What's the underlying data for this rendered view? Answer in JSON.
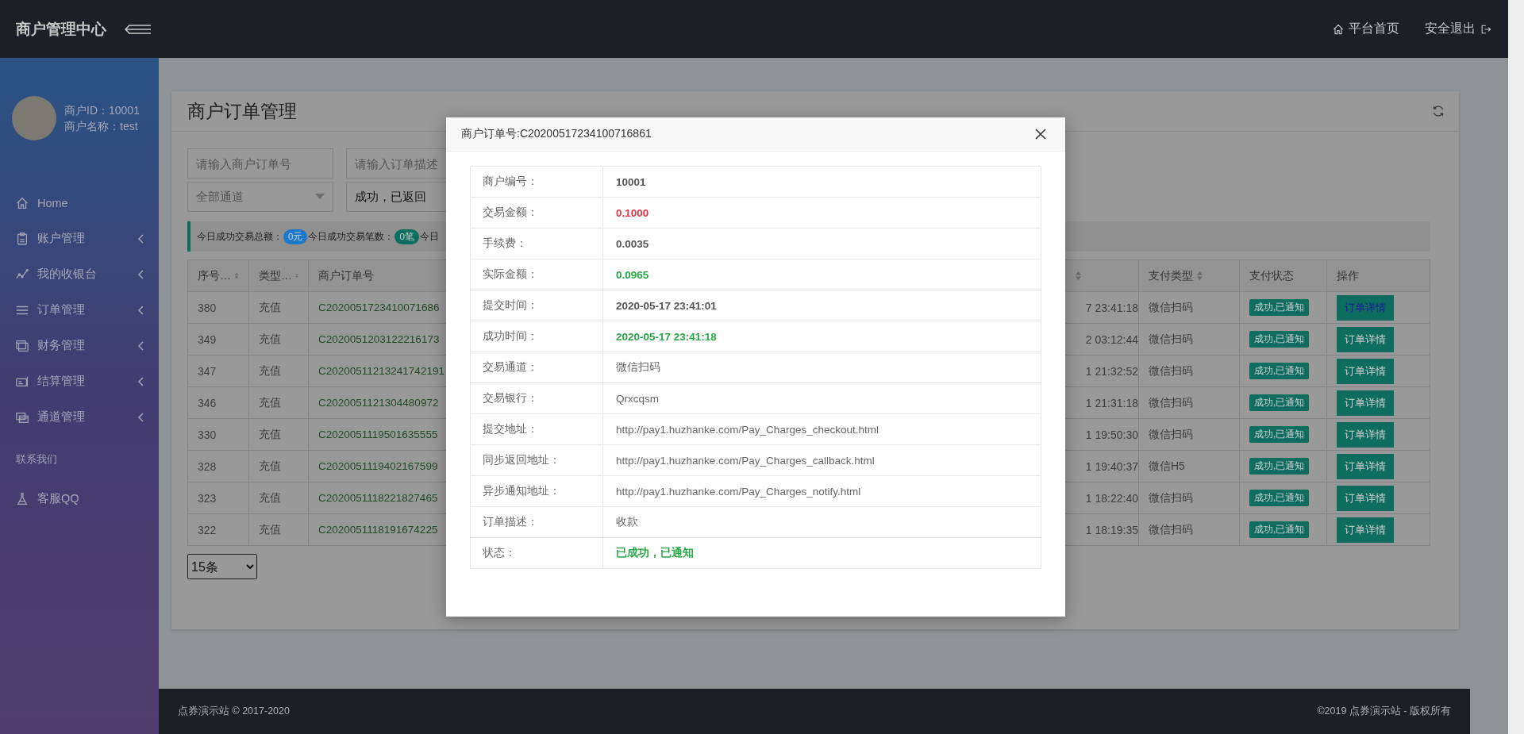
{
  "header": {
    "title": "商户管理中心",
    "links": [
      {
        "label": "平台首页"
      },
      {
        "label": "安全退出"
      }
    ]
  },
  "sidebar": {
    "user": {
      "id_line": "商户ID：10001",
      "name_line": "商户名称：test"
    },
    "menu": [
      {
        "label": "Home",
        "has_submenu": false
      },
      {
        "label": "账户管理",
        "has_submenu": true
      },
      {
        "label": "我的收银台",
        "has_submenu": true
      },
      {
        "label": "订单管理",
        "has_submenu": true
      },
      {
        "label": "财务管理",
        "has_submenu": true
      },
      {
        "label": "结算管理",
        "has_submenu": true
      },
      {
        "label": "通道管理",
        "has_submenu": true
      }
    ],
    "section_title": "联系我们",
    "contact": [
      {
        "label": "客服QQ",
        "has_submenu": false
      }
    ]
  },
  "page": {
    "title": "商户订单管理",
    "filters": [
      {
        "kind": "text",
        "placeholder": "请输入商户订单号"
      },
      {
        "kind": "text",
        "placeholder": "请输入订单描述"
      },
      {
        "kind": "dropdown",
        "value": "全部通道"
      },
      {
        "kind": "plain",
        "value": "成功，已返回"
      }
    ],
    "stats": [
      {
        "label": "今日成功交易总额：",
        "badge": "0元",
        "color": "#1d7acb"
      },
      {
        "label": "今日成功交易笔数：",
        "badge": "0笔",
        "color": "#0f6d5f"
      },
      {
        "label": "今日"
      }
    ],
    "table": {
      "columns": [
        {
          "label": "序号…",
          "sort": true
        },
        {
          "label": "类型…",
          "sort": true
        },
        {
          "label": "商户订单号",
          "sort": false
        },
        {
          "sort": true
        },
        {
          "label": "支付类型",
          "sort": true
        },
        {
          "label": "支付状态",
          "sort": false
        },
        {
          "label": "操作",
          "sort": false
        }
      ],
      "rows": [
        {
          "id": "380",
          "type": "充值",
          "order_no": "C2020051723410071686",
          "column_4": "7 23:41:18",
          "pay_type": "微信扫码",
          "status": "成功,已通知",
          "action": "订单详情",
          "selected": true
        },
        {
          "id": "349",
          "type": "充值",
          "order_no": "C2020051203122216173",
          "column_4": "2 03:12:44",
          "pay_type": "微信扫码",
          "status": "成功,已通知",
          "action": "订单详情",
          "selected": false
        },
        {
          "id": "347",
          "type": "充值",
          "order_no": "C20200511213241742191",
          "column_4": "1 21:32:52",
          "pay_type": "微信扫码",
          "status": "成功,已通知",
          "action": "订单详情",
          "selected": false
        },
        {
          "id": "346",
          "type": "充值",
          "order_no": "C2020051121304480972",
          "column_4": "1 21:31:18",
          "pay_type": "微信扫码",
          "status": "成功,已通知",
          "action": "订单详情",
          "selected": false
        },
        {
          "id": "330",
          "type": "充值",
          "order_no": "C2020051119501635555",
          "column_4": "1 19:50:30",
          "pay_type": "微信扫码",
          "status": "成功,已通知",
          "action": "订单详情",
          "selected": false
        },
        {
          "id": "328",
          "type": "充值",
          "order_no": "C2020051119402167599",
          "column_4": "1 19:40:37",
          "pay_type": "微信H5",
          "status": "成功,已通知",
          "action": "订单详情",
          "selected": false
        },
        {
          "id": "323",
          "type": "充值",
          "order_no": "C2020051118221827465",
          "column_4": "1 18:22:40",
          "pay_type": "微信扫码",
          "status": "成功,已通知",
          "action": "订单详情",
          "selected": false
        },
        {
          "id": "322",
          "type": "充值",
          "order_no": "C2020051118191674225",
          "column_4": "1 18:19:35",
          "pay_type": "微信扫码",
          "status": "成功,已通知",
          "action": "订单详情",
          "selected": false
        }
      ]
    },
    "page_size": "15条"
  },
  "footer": {
    "left": "点券演示站 © 2017-2020",
    "right": "©2019 点券演示站 - 版权所有"
  },
  "modal": {
    "title": "商户订单号:C20200517234100716861",
    "rows": [
      {
        "label": "商户编号：",
        "value": "10001",
        "kind": "bold"
      },
      {
        "label": "交易金额：",
        "value": "0.1000",
        "kind": "danger"
      },
      {
        "label": "手续费：",
        "value": "0.0035",
        "kind": "bold"
      },
      {
        "label": "实际金额：",
        "value": "0.0965",
        "kind": "success"
      },
      {
        "label": "提交时间：",
        "value": "2020-05-17 23:41:01",
        "kind": "bold"
      },
      {
        "label": "成功时间：",
        "value": "2020-05-17 23:41:18",
        "kind": "success"
      },
      {
        "label": "交易通道：",
        "value": "微信扫码",
        "kind": "normal"
      },
      {
        "label": "交易银行：",
        "value": "Qrxcqsm",
        "kind": "normal"
      },
      {
        "label": "提交地址：",
        "value": "http://pay1.huzhanke.com/Pay_Charges_checkout.html",
        "kind": "normal"
      },
      {
        "label": "同步返回地址：",
        "value": "http://pay1.huzhanke.com/Pay_Charges_callback.html",
        "kind": "normal"
      },
      {
        "label": "异步通知地址：",
        "value": "http://pay1.huzhanke.com/Pay_Charges_notify.html",
        "kind": "normal"
      },
      {
        "label": "订单描述：",
        "value": "收款",
        "kind": "normal"
      },
      {
        "label": "状态：",
        "value": "已成功，已通知",
        "kind": "success"
      }
    ]
  }
}
